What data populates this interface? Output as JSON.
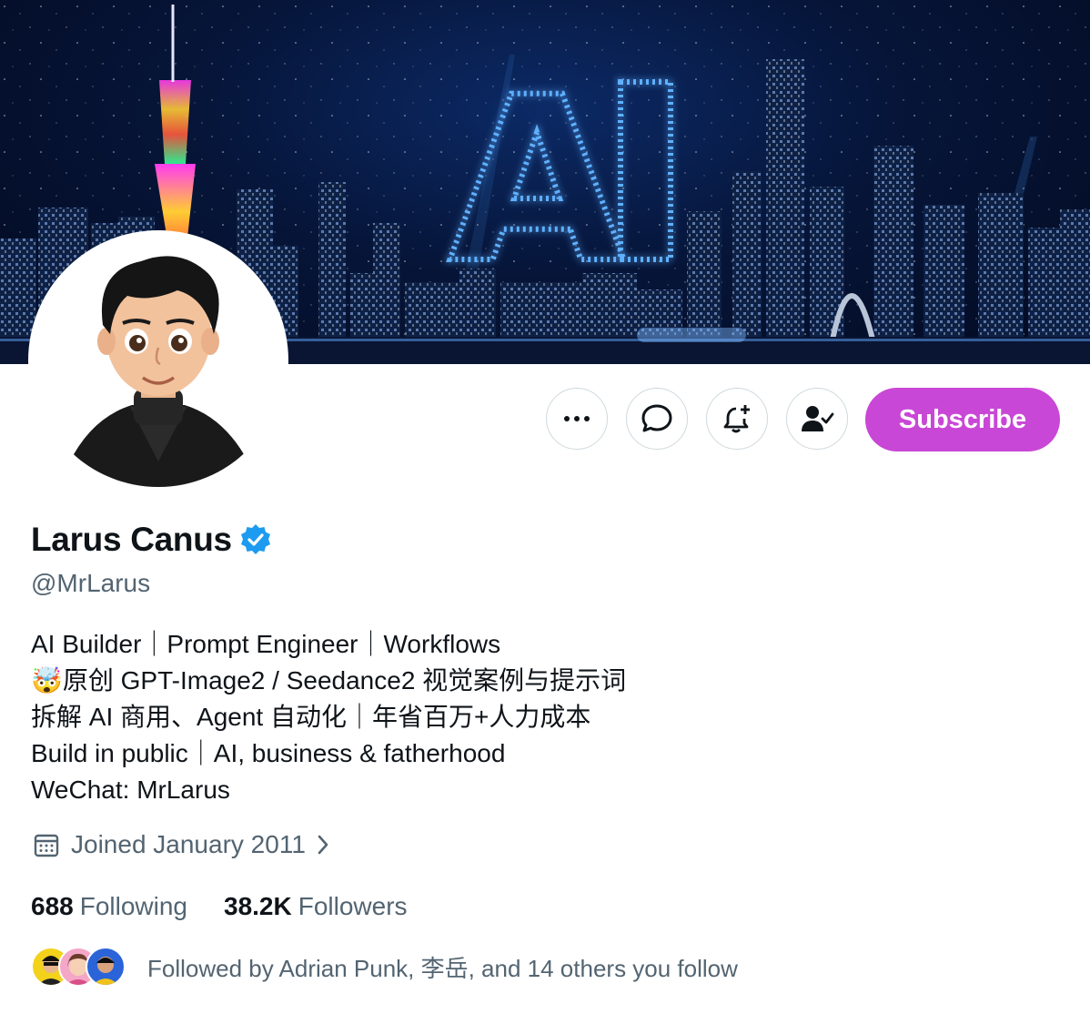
{
  "profile": {
    "name": "Larus Canus",
    "handle": "@MrLarus",
    "bio": [
      "AI Builder｜Prompt Engineer｜Workflows",
      "🤯原创 GPT-Image2 / Seedance2 视觉案例与提示词",
      "拆解 AI 商用、Agent 自动化｜年省百万+人力成本",
      "Build in public｜AI, business & fatherhood",
      "WeChat: MrLarus"
    ],
    "joined": "Joined January 2011",
    "following_count": "688",
    "following_label": "Following",
    "followers_count": "38.2K",
    "followers_label": "Followers",
    "followed_by": "Followed by Adrian Punk, 李岳, and 14 others you follow"
  },
  "banner": {
    "text": "AI"
  },
  "actions": {
    "more_icon": "more-dots-icon",
    "message_icon": "chat-bubble-icon",
    "notify_icon": "bell-plus-icon",
    "following_icon": "person-check-icon",
    "subscribe_label": "Subscribe"
  },
  "colors": {
    "subscribe": "#c947d6",
    "verified": "#1d9bf0",
    "secondary_text": "#536471",
    "border": "#cfd9de"
  }
}
